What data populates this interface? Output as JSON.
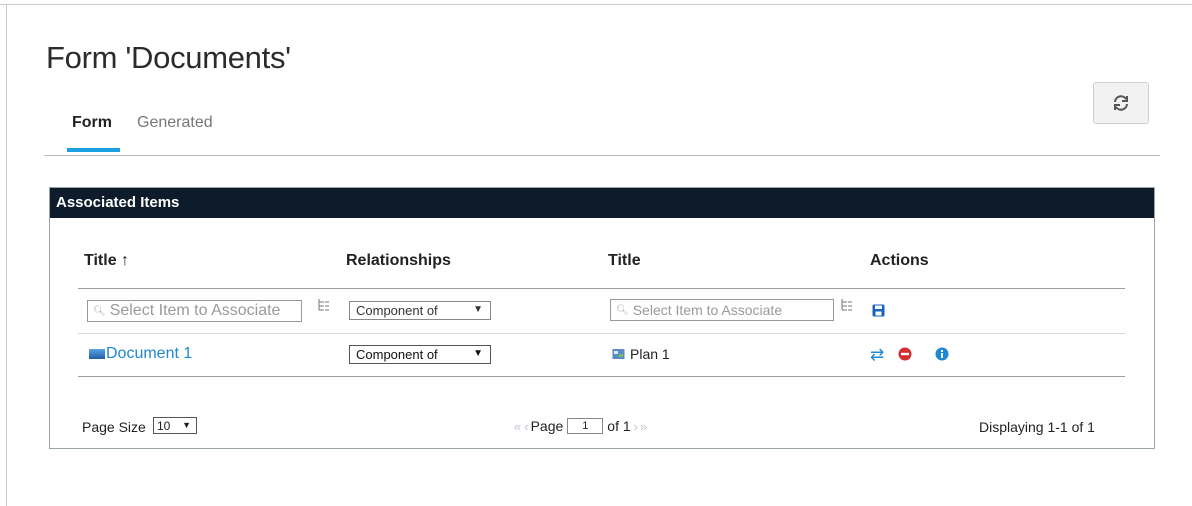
{
  "page": {
    "title": "Form 'Documents'"
  },
  "tabs": [
    {
      "label": "Form"
    },
    {
      "label": "Generated"
    }
  ],
  "refresh": {
    "icon": "refresh-icon"
  },
  "panel": {
    "title": "Associated Items",
    "columns": [
      "Title ↑",
      "Relationships",
      "Title",
      "Actions"
    ],
    "new_row": {
      "left_placeholder": "Select Item to Associate",
      "relationship": "Component of",
      "right_placeholder": "Select Item to Associate"
    },
    "rows": [
      {
        "left": "Document 1",
        "relationship": "Component of",
        "right": "Plan 1"
      }
    ],
    "footer": {
      "page_size_label": "Page Size",
      "page_size": "10",
      "page_label": "Page",
      "page_number": "1",
      "of_label": "of 1",
      "displaying": "Displaying 1-1 of 1"
    }
  },
  "colors": {
    "accent": "#1ba1e2",
    "header_bg": "#0d1b2a",
    "link": "#1e88d0",
    "remove": "#d32f2f",
    "info": "#1e88d0"
  }
}
